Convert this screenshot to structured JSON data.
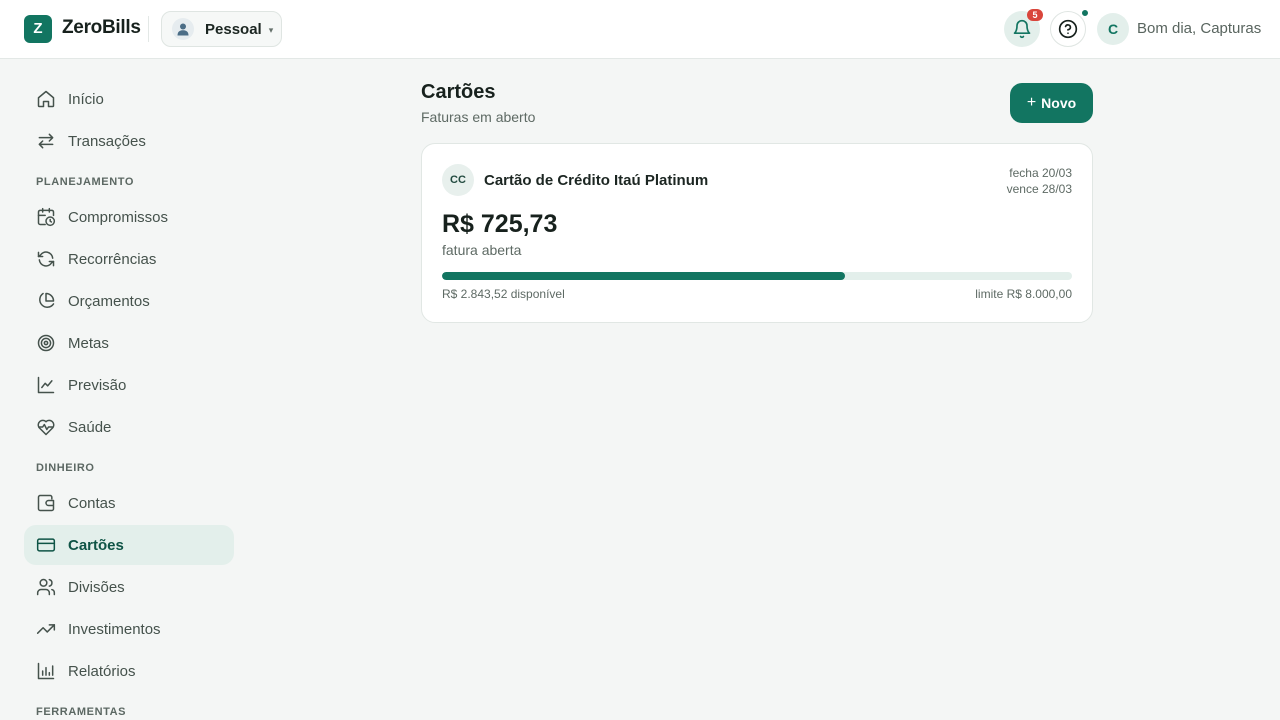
{
  "app": {
    "logo_letter": "Z",
    "name": "ZeroBills",
    "accent_color": "#127561"
  },
  "header": {
    "workspace": {
      "label": "Pessoal",
      "icon": "person-icon",
      "caret": "▾"
    },
    "notifications": {
      "icon": "bell-icon",
      "count": "5"
    },
    "help": {
      "icon": "help-circle-icon"
    },
    "user": {
      "avatar_initial": "C",
      "greeting": "Bom dia, Capturas"
    }
  },
  "sidebar": {
    "items": [
      {
        "label": "Início",
        "icon": "home-icon"
      },
      {
        "label": "Transações",
        "icon": "arrows-swap-icon"
      }
    ],
    "sections": [
      {
        "title": "PLANEJAMENTO",
        "items": [
          {
            "label": "Compromissos",
            "icon": "calendar-clock-icon"
          },
          {
            "label": "Recorrências",
            "icon": "refresh-icon"
          },
          {
            "label": "Orçamentos",
            "icon": "pie-chart-icon"
          },
          {
            "label": "Metas",
            "icon": "target-icon"
          },
          {
            "label": "Previsão",
            "icon": "line-chart-icon"
          },
          {
            "label": "Saúde",
            "icon": "heart-pulse-icon"
          }
        ]
      },
      {
        "title": "DINHEIRO",
        "items": [
          {
            "label": "Contas",
            "icon": "wallet-icon"
          },
          {
            "label": "Cartões",
            "icon": "credit-card-icon",
            "active": true
          },
          {
            "label": "Divisões",
            "icon": "users-icon"
          },
          {
            "label": "Investimentos",
            "icon": "trending-up-icon"
          },
          {
            "label": "Relatórios",
            "icon": "bar-chart-icon"
          }
        ]
      },
      {
        "title": "FERRAMENTAS",
        "items": []
      }
    ]
  },
  "main": {
    "title": "Cartões",
    "subtitle": "Faturas em aberto",
    "new_button": {
      "plus": "+",
      "label": "Novo"
    },
    "cards": [
      {
        "badge": "CC",
        "name": "Cartão de Crédito Itaú Platinum",
        "closes": "fecha 20/03",
        "due": "vence 28/03",
        "amount": "R$ 725,73",
        "amount_label": "fatura aberta",
        "limit_used_fraction": 0.64,
        "available": "R$ 2.843,52 disponível",
        "limit": "limite R$ 8.000,00"
      }
    ]
  }
}
